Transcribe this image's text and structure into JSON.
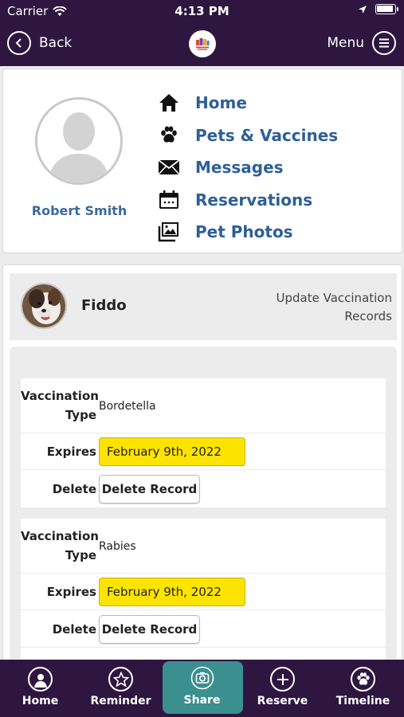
{
  "status_bar": {
    "carrier": "Carrier",
    "time": "4:13 PM"
  },
  "header": {
    "back_label": "Back",
    "menu_label": "Menu"
  },
  "profile": {
    "user_name": "Robert Smith",
    "nav": [
      {
        "label": "Home",
        "icon": "home-icon"
      },
      {
        "label": "Pets & Vaccines",
        "icon": "paw-icon"
      },
      {
        "label": "Messages",
        "icon": "envelope-icon"
      },
      {
        "label": "Reservations",
        "icon": "calendar-icon"
      },
      {
        "label": "Pet Photos",
        "icon": "photos-icon"
      }
    ]
  },
  "pet": {
    "name": "Fiddo",
    "update_label": "Update Vaccination Records",
    "records": [
      {
        "type_label": "Vaccination Type",
        "type_value": "Bordetella",
        "expires_label": "Expires",
        "expires_value": "February 9th, 2022",
        "delete_label": "Delete",
        "delete_button": "Delete Record"
      },
      {
        "type_label": "Vaccination Type",
        "type_value": "Rabies",
        "expires_label": "Expires",
        "expires_value": "February 9th, 2022",
        "delete_label": "Delete",
        "delete_button": "Delete Record"
      }
    ]
  },
  "tabs": [
    {
      "label": "Home",
      "icon": "user-icon"
    },
    {
      "label": "Reminder",
      "icon": "star-icon"
    },
    {
      "label": "Share",
      "icon": "camera-icon",
      "active": true
    },
    {
      "label": "Reserve",
      "icon": "plus-icon"
    },
    {
      "label": "Timeline",
      "icon": "paw-icon"
    }
  ],
  "colors": {
    "brand_purple": "#2f1640",
    "link_blue": "#2e5f96",
    "date_yellow": "#fde300",
    "active_tab": "#3b8f8f"
  }
}
